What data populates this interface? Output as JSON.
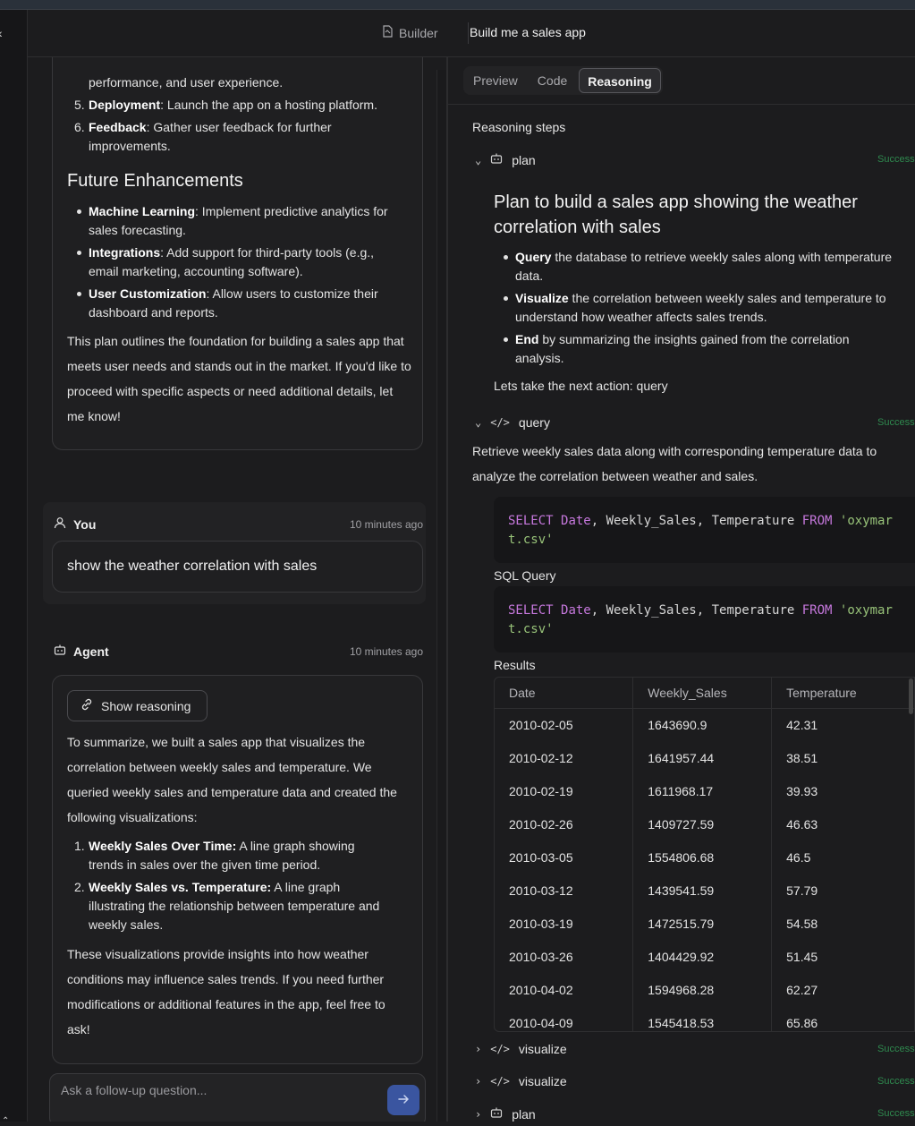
{
  "header": {
    "builder_label": "Builder",
    "title": "Build me a sales app"
  },
  "chat": {
    "card1": {
      "list_top": [
        {
          "num": "",
          "bold": "",
          "text": "performance, and user experience."
        },
        {
          "num": "5.",
          "bold": "Deployment",
          "text": ": Launch the app on a hosting platform."
        },
        {
          "num": "6.",
          "bold": "Feedback",
          "text": ": Gather user feedback for further"
        },
        {
          "num": "",
          "bold": "",
          "text": "improvements."
        }
      ],
      "heading": "Future Enhancements",
      "bullets": [
        {
          "bold": "Machine Learning",
          "line1": ": Implement predictive analytics for",
          "line2": "sales forecasting."
        },
        {
          "bold": "Integrations",
          "line1": ": Add support for third-party tools (e.g.,",
          "line2": "email marketing, accounting software)."
        },
        {
          "bold": "User Customization",
          "line1": ": Allow users to customize their",
          "line2": "dashboard and reports."
        }
      ],
      "closing": "This plan outlines the foundation for building a sales app that meets user needs and stands out in the market. If you'd like to proceed with specific aspects or need additional details, let me know!"
    },
    "you": {
      "name": "You",
      "time": "10 minutes ago",
      "message": "show the weather correlation with sales"
    },
    "agent": {
      "name": "Agent",
      "time": "10 minutes ago",
      "show_reasoning": "Show reasoning",
      "intro": "To summarize, we built a sales app that visualizes the correlation between weekly sales and temperature. We queried weekly sales and temperature data and created the following visualizations:",
      "items": [
        {
          "num": "1.",
          "bold": "Weekly Sales Over Time:",
          "line1": " A line graph showing",
          "line2": "trends in sales over the given time period."
        },
        {
          "num": "2.",
          "bold": "Weekly Sales vs. Temperature:",
          "line1": " A line graph",
          "line2": "illustrating the relationship between temperature and",
          "line3": "weekly sales."
        }
      ],
      "outro": "These visualizations provide insights into how weather conditions may influence sales trends. If you need further modifications or additional features in the app, feel free to ask!"
    },
    "input_placeholder": "Ask a follow-up question..."
  },
  "right": {
    "tabs": [
      "Preview",
      "Code",
      "Reasoning"
    ],
    "active_tab": "Reasoning",
    "reasoning_title": "Reasoning steps",
    "status": "Success",
    "plan_step": "plan",
    "plan_heading": "Plan to build a sales app showing the weather correlation with sales",
    "plan_bullets": [
      {
        "bold": "Query",
        "line1": " the database to retrieve weekly sales along with temperature",
        "line2": "data."
      },
      {
        "bold": "Visualize",
        "line1": " the correlation between weekly sales and temperature to",
        "line2": "understand how weather affects sales trends."
      },
      {
        "bold": "End",
        "line1": " by summarizing the insights gained from the correlation",
        "line2": "analysis."
      }
    ],
    "next_action": "Lets take the next action: query",
    "query_step": "query",
    "query_desc": "Retrieve weekly sales data along with corresponding temperature data to analyze the correlation between weather and sales.",
    "sql_query_label": "SQL Query",
    "results_label": "Results",
    "columns": [
      "Date",
      "Weekly_Sales",
      "Temperature"
    ],
    "rows": [
      [
        "2010-02-05",
        "1643690.9",
        "42.31"
      ],
      [
        "2010-02-12",
        "1641957.44",
        "38.51"
      ],
      [
        "2010-02-19",
        "1611968.17",
        "39.93"
      ],
      [
        "2010-02-26",
        "1409727.59",
        "46.63"
      ],
      [
        "2010-03-05",
        "1554806.68",
        "46.5"
      ],
      [
        "2010-03-12",
        "1439541.59",
        "57.79"
      ],
      [
        "2010-03-19",
        "1472515.79",
        "54.58"
      ],
      [
        "2010-03-26",
        "1404429.92",
        "51.45"
      ],
      [
        "2010-04-02",
        "1594968.28",
        "62.27"
      ],
      [
        "2010-04-09",
        "1545418.53",
        "65.86"
      ]
    ],
    "collapsed_steps": [
      "visualize",
      "visualize",
      "plan"
    ]
  }
}
